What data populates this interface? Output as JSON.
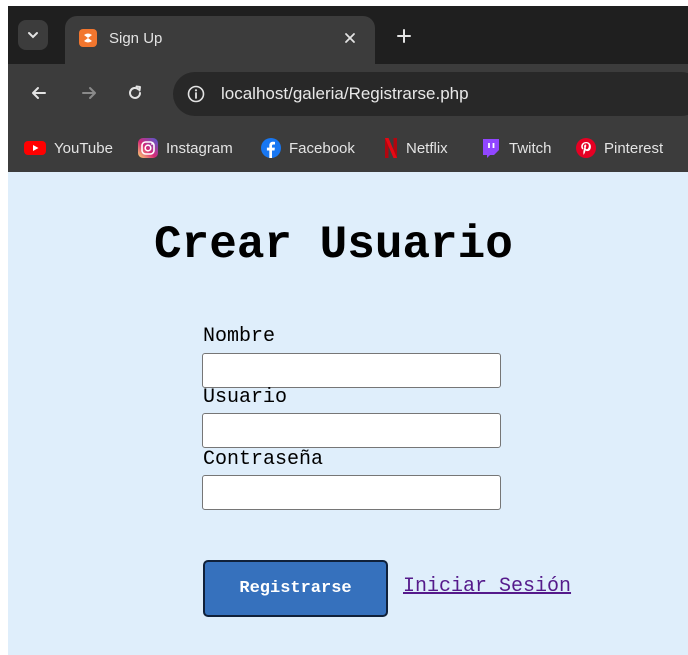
{
  "browser": {
    "tab": {
      "title": "Sign Up",
      "favicon": "xampp-icon"
    },
    "url": "localhost/galeria/Registrarse.php",
    "bookmarks": [
      {
        "label": "YouTube",
        "icon": "youtube-icon",
        "color": "#ff0000"
      },
      {
        "label": "Instagram",
        "icon": "instagram-icon",
        "color": "#e1306c"
      },
      {
        "label": "Facebook",
        "icon": "facebook-icon",
        "color": "#1877f2"
      },
      {
        "label": "Netflix",
        "icon": "netflix-icon",
        "color": "#e50914"
      },
      {
        "label": "Twitch",
        "icon": "twitch-icon",
        "color": "#9146ff"
      },
      {
        "label": "Pinterest",
        "icon": "pinterest-icon",
        "color": "#e60023"
      }
    ]
  },
  "page": {
    "heading": "Crear Usuario",
    "form": {
      "name_label": "Nombre",
      "name_value": "",
      "user_label": "Usuario",
      "user_value": "",
      "password_label": "Contraseña",
      "password_value": "",
      "submit_label": "Registrarse",
      "login_link": "Iniciar Sesión"
    }
  },
  "colors": {
    "page_background": "#dfeefb",
    "button": "#3671bd",
    "link": "#551a8b"
  }
}
